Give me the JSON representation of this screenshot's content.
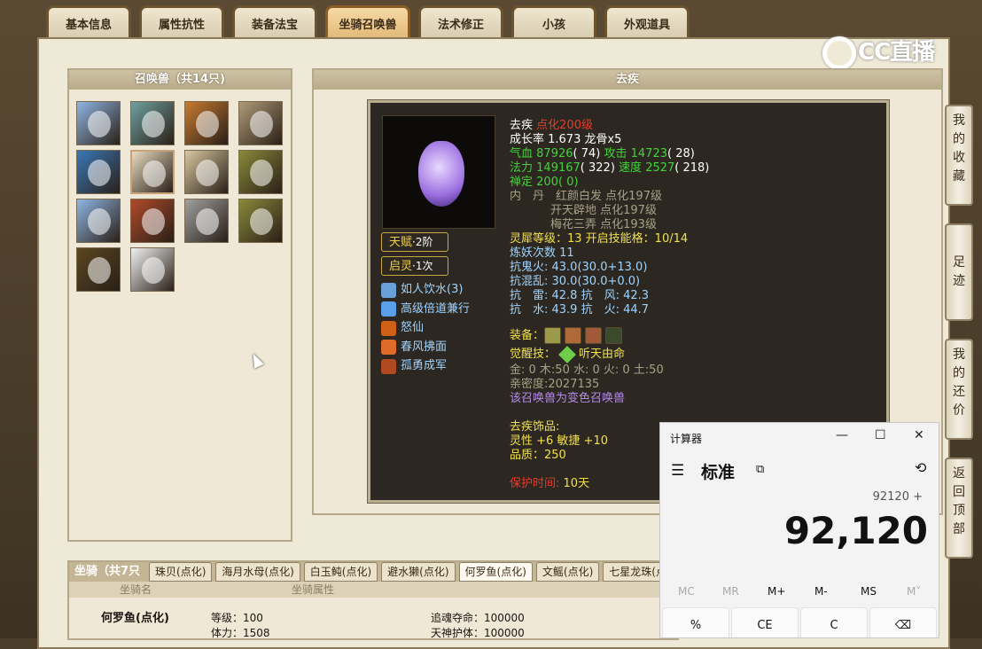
{
  "tabs": [
    "基本信息",
    "属性抗性",
    "装备法宝",
    "坐骑召唤兽",
    "法术修正",
    "小孩",
    "外观道具"
  ],
  "watermark": "CC直播",
  "summon_list": {
    "title": "召唤兽（共14只)",
    "avatar_colors": [
      "#8fb6e4",
      "#6fa0a0",
      "#c87a30",
      "#b09a78",
      "#3a78b8",
      "#e8dcc0",
      "#d9c8a0",
      "#8a8a3a",
      "#8fb6e4",
      "#b04a2a",
      "#a0a0a0",
      "#8a8a3a",
      "#5a4620",
      "#f2f2f2"
    ]
  },
  "detail": {
    "header": "去疾",
    "talent": {
      "label": "天赋",
      "value": "·2阶"
    },
    "awaken": {
      "label": "启灵",
      "value": "·1次"
    },
    "skills": [
      {
        "name": "如人饮水(3)",
        "icon": "water-icon",
        "color": "#6aa0d8"
      },
      {
        "name": "高级倍道兼行",
        "icon": "speed-icon",
        "color": "#5aa0e8"
      },
      {
        "name": "怒仙",
        "icon": "fire-ring-icon",
        "color": "#d06018"
      },
      {
        "name": "春风拂面",
        "icon": "flame-icon",
        "color": "#e06a2a"
      },
      {
        "name": "孤勇成军",
        "icon": "warrior-icon",
        "color": "#b04a20"
      }
    ],
    "info": {
      "name": "去疾",
      "level": "点化200级",
      "growth": "成长率 1.673 龙骨x5",
      "hp_label": "气血",
      "hp": "87926",
      "hp_paren": "( 74)",
      "atk_label": "攻击",
      "atk": "14723",
      "atk_paren": "( 28)",
      "mp_label": "法力",
      "mp": "149167",
      "mp_paren": "( 322)",
      "spd_label": "速度",
      "spd": "2527",
      "spd_paren": "( 218)",
      "zen_label": "禅定",
      "zen": "200",
      "zen_paren": "( 0)",
      "neidan_label": "内　丹",
      "neidan": [
        "红颜白发 点化197级",
        "开天辟地 点化197级",
        "梅花三弄 点化193级"
      ],
      "lingxi": "灵犀等级：13 开启技能格：10/14",
      "lianyao": "炼妖次数 11",
      "res1": "抗鬼火: 43.0(30.0+13.0)",
      "res2": "抗混乱: 30.0(30.0+0.0)",
      "res3": "抗　雷: 42.8 抗　风: 42.3",
      "res4": "抗　水: 43.9 抗　火: 44.7",
      "equip_label": "装备：",
      "equip_colors": [
        "#9a9a4a",
        "#b06a3a",
        "#a05a3a",
        "#3a4a2a"
      ],
      "awaken_skill_label": "觉醒技：",
      "awaken_skill": "听天由命",
      "elements": "金: 0 木:50 水: 0 火: 0 土:50",
      "intimacy": "亲密度:2027135",
      "variant": "该召唤兽为变色召唤兽",
      "orn_title": "去疾饰品:",
      "orn_attr": "灵性 +6 敏捷 +10",
      "orn_quality": "品质：250",
      "protect_label": "保护时间:",
      "protect_value": "10天"
    }
  },
  "side": [
    {
      "name": "我的收藏",
      "chars": [
        "我",
        "的",
        "收",
        "藏"
      ]
    },
    {
      "name": "足迹",
      "chars": [
        "足",
        "迹"
      ]
    },
    {
      "name": "我的还价",
      "chars": [
        "我",
        "的",
        "还",
        "价"
      ]
    },
    {
      "name": "返回顶部",
      "chars": [
        "返",
        "回",
        "顶",
        "部"
      ]
    }
  ],
  "mounts": {
    "title": "坐骑（共7只",
    "tabs": [
      "珠贝(点化)",
      "海月水母(点化)",
      "白玉鲀(点化)",
      "避水獭(点化)",
      "何罗鱼(点化)",
      "文鳐(点化)",
      "七星龙珠(点"
    ],
    "active": 4,
    "col1": "坐骑名",
    "col2": "坐骑属性",
    "row_name": "何罗鱼(点化)",
    "grade": "等级：100",
    "hp": "体力：1508",
    "attr1": "追魂夺命：100000",
    "attr2": "天神护体：100000"
  },
  "calculator": {
    "title": "计算器",
    "mode": "标准",
    "expression": "92120 +",
    "display": "92,120",
    "memory": [
      "MC",
      "MR",
      "M+",
      "M-",
      "MS",
      "M˅"
    ],
    "keys": [
      "%",
      "CE",
      "C",
      "⌫"
    ]
  }
}
